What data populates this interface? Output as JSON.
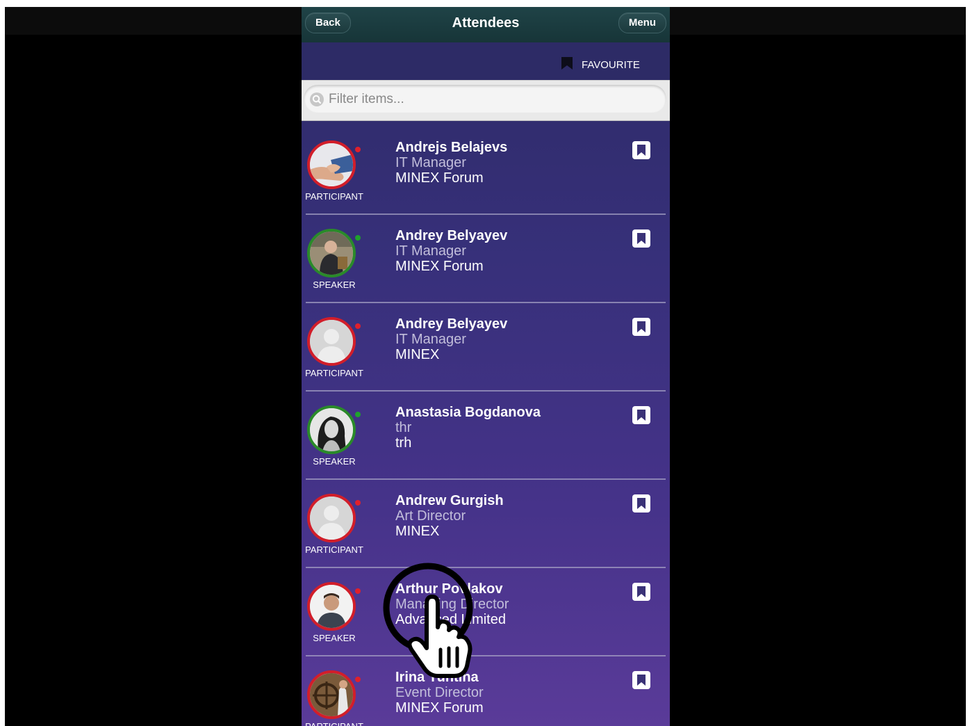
{
  "header": {
    "back_label": "Back",
    "title": "Attendees",
    "menu_label": "Menu"
  },
  "favourite": {
    "label": "FAVOURITE"
  },
  "filter": {
    "placeholder": "Filter items..."
  },
  "attendees": [
    {
      "name": "Andrejs Belajevs",
      "job_title": "IT Manager",
      "company": "MINEX Forum",
      "role": "PARTICIPANT",
      "status": "red",
      "avatar": "handshake-photo"
    },
    {
      "name": "Andrey Belyayev",
      "job_title": "IT Manager",
      "company": "MINEX Forum",
      "role": "SPEAKER",
      "status": "green",
      "avatar": "man-seated-photo"
    },
    {
      "name": "Andrey Belyayev",
      "job_title": "IT Manager",
      "company": "MINEX",
      "role": "PARTICIPANT",
      "status": "red",
      "avatar": "default-silhouette"
    },
    {
      "name": "Anastasia Bogdanova",
      "job_title": "thr",
      "company": "trh",
      "role": "SPEAKER",
      "status": "green",
      "avatar": "woman-bw-photo"
    },
    {
      "name": "Andrew Gurgish",
      "job_title": "Art Director",
      "company": "MINEX",
      "role": "PARTICIPANT",
      "status": "red",
      "avatar": "default-silhouette"
    },
    {
      "name": "Arthur Povlakov",
      "job_title": "Managing Director",
      "company": "Advanced Limited",
      "role": "SPEAKER",
      "status": "red",
      "avatar": "man-portrait-photo"
    },
    {
      "name": "Irina Yuntina",
      "job_title": "Event Director",
      "company": "MINEX Forum",
      "role": "PARTICIPANT",
      "status": "red",
      "avatar": "ship-wheel-photo"
    }
  ],
  "colors": {
    "header_bg": "#1c3a3d",
    "list_bg_top": "#2d2a66",
    "list_bg_bottom": "#5a3b99",
    "participant_ring": "#d21e2a",
    "speaker_ring": "#2a8a2a"
  }
}
